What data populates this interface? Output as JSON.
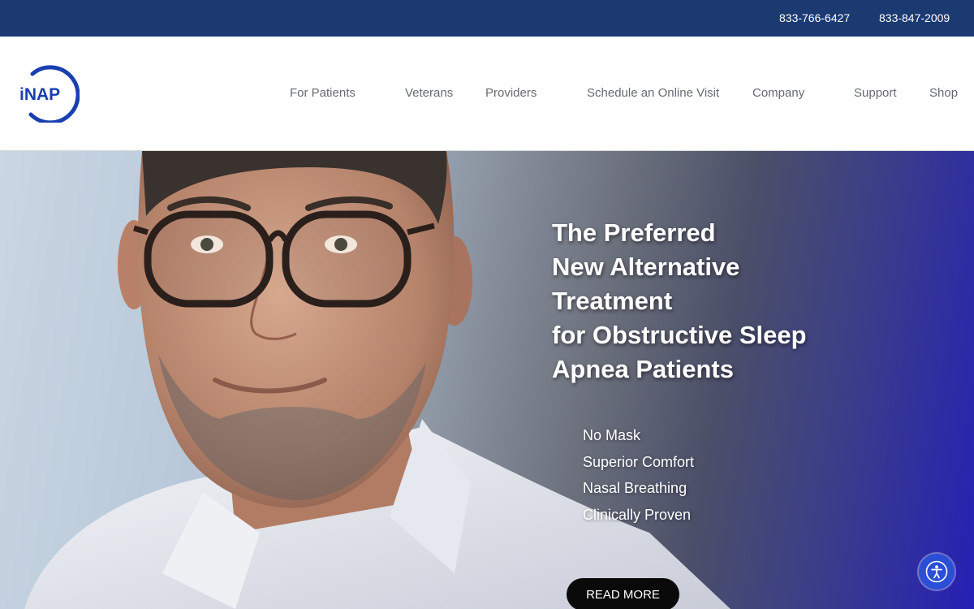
{
  "topbar": {
    "phone_1": "833-766-6427",
    "phone_2": "833-847-2009"
  },
  "logo": {
    "text": "iNAP"
  },
  "nav": {
    "items": [
      {
        "label": "For Patients"
      },
      {
        "label": "Veterans"
      },
      {
        "label": "Providers"
      },
      {
        "label": "Schedule an Online Visit"
      },
      {
        "label": "Company"
      },
      {
        "label": "Support"
      },
      {
        "label": "Shop"
      }
    ]
  },
  "hero": {
    "heading_lines": [
      "The Preferred",
      "New Alternative",
      "Treatment",
      "for Obstructive Sleep",
      "Apnea Patients"
    ],
    "benefits": [
      "No Mask",
      "Superior Comfort",
      "Nasal Breathing",
      "Clinically Proven"
    ],
    "cta_label": "READ MORE"
  },
  "icons": {
    "accessibility": "accessibility-icon"
  },
  "colors": {
    "topbar": "#1c3a72",
    "logo_blue": "#1a3fb0",
    "cta": "#0a0a0a",
    "accessibility_button": "#2a4fd6"
  }
}
